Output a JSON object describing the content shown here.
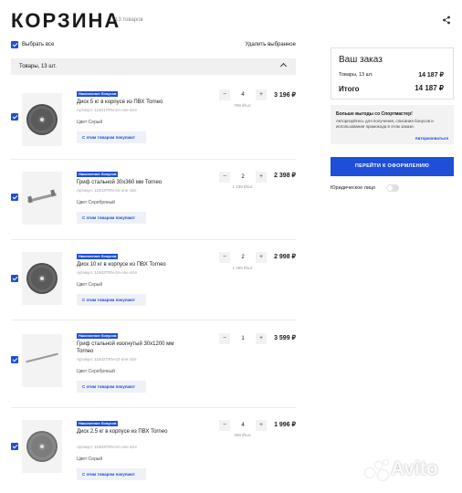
{
  "page": {
    "title": "КОРЗИНА",
    "count": "13 товаров"
  },
  "select_bar": {
    "select_all": "Выбрать все",
    "delete_selected": "Удалить выбранное"
  },
  "group": {
    "label": "Товары, 13 шт."
  },
  "items": [
    {
      "badge": "Накопление бонусов",
      "name": "Диск 5 кг в корпусе из ПВХ Torneo",
      "article": "Артикул: 11901TRN-2A-one size",
      "color": "Цвет:Серый",
      "buy_together": "С этим товаром покупают",
      "qty": "4",
      "unit_price": "799 ₽/шт.",
      "price": "3 196 ₽"
    },
    {
      "badge": "Накопление бонусов",
      "name": "Гриф стальной 30х360 мм Torneo",
      "article": "Артикул: 11843TRN-02-one size",
      "color": "Цвет:Серебряный",
      "buy_together": "С этим товаром покупают",
      "qty": "2",
      "unit_price": "1 199 ₽/шт.",
      "price": "2 398 ₽"
    },
    {
      "badge": "Накопление бонусов",
      "name": "Диск 10 кг в корпусе из ПВХ Torneo",
      "article": "Артикул: 11902TRN-2A-one size",
      "color": "Цвет:Серый",
      "buy_together": "С этим товаром покупают",
      "qty": "2",
      "unit_price": "1 499 ₽/шт.",
      "price": "2 998 ₽"
    },
    {
      "badge": "Накопление бонусов",
      "name": "Гриф стальной изогнутый 30х1200 мм Torneo",
      "article": "Артикул: 11842TRN-02-one size",
      "color": "Цвет:Серебряный",
      "buy_together": "С этим товаром покупают",
      "qty": "1",
      "unit_price": "",
      "price": "3 599 ₽"
    },
    {
      "badge": "Накопление бонусов",
      "name": "Диск 2.5 кг в корпусе из ПВХ Torneo",
      "article": "Артикул: 11903TRN-2A-one size",
      "color": "Цвет:Серый",
      "buy_together": "С этим товаром покупают",
      "qty": "4",
      "unit_price": "499 ₽/шт.",
      "price": "1 996 ₽"
    }
  ],
  "order": {
    "heading": "Ваш заказ",
    "items_label": "Товары, 13 шт.",
    "items_value": "14 187 ₽",
    "total_label": "Итого",
    "total_value": "14 187 ₽"
  },
  "promo": {
    "title": "Больше выгоды со Спортмастер!",
    "desc": "Авторизуйтесь для получения, списания бонусов и использования промокода в этом заказе.",
    "action": "Авторизоваться"
  },
  "checkout": {
    "label": "ПЕРЕЙТИ К ОФОРМЛЕНИЮ"
  },
  "legal": {
    "label": "Юридическое лицо"
  },
  "watermark": {
    "text": "Avito"
  },
  "colors": {
    "accent": "#1e4fd6",
    "group_bg": "#f0f0f0"
  }
}
